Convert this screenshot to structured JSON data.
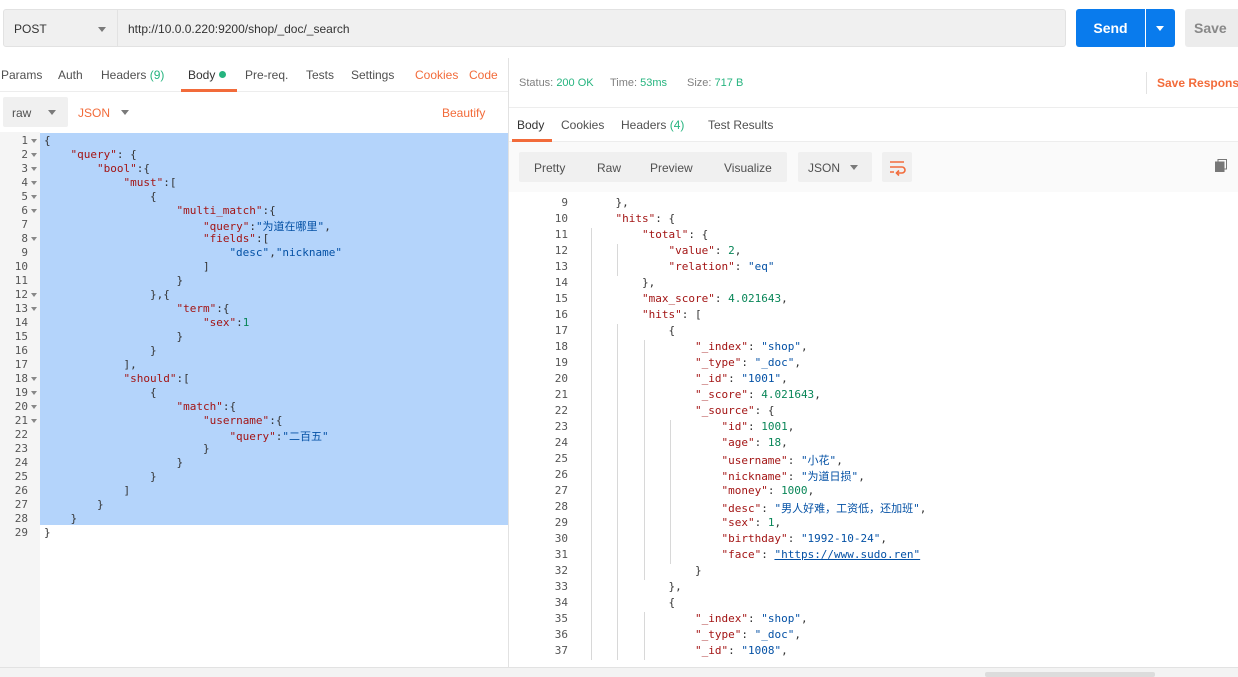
{
  "request": {
    "method": "POST",
    "url": "http://10.0.0.220:9200/shop/_doc/_search",
    "send_label": "Send",
    "save_label": "Save"
  },
  "request_tabs": [
    {
      "label": "Params"
    },
    {
      "label": "Auth"
    },
    {
      "label": "Headers",
      "count": "(9)"
    },
    {
      "label": "Body"
    },
    {
      "label": "Pre-req."
    },
    {
      "label": "Tests"
    },
    {
      "label": "Settings"
    },
    {
      "label": "Cookies"
    },
    {
      "label": "Code"
    }
  ],
  "body_options": {
    "mode": "raw",
    "format": "JSON",
    "beautify_label": "Beautify"
  },
  "request_body_lines": [
    "{",
    "    \"query\": {",
    "        \"bool\":{",
    "            \"must\":[",
    "                {",
    "                    \"multi_match\":{",
    "                        \"query\":\"为道在哪里\",",
    "                        \"fields\":[",
    "                            \"desc\",\"nickname\"",
    "                        ]",
    "                    }",
    "                },{",
    "                    \"term\":{",
    "                        \"sex\":1",
    "                    }",
    "                }",
    "            ],",
    "            \"should\":[",
    "                {",
    "                    \"match\":{",
    "                        \"username\":{",
    "                            \"query\":\"二百五\"",
    "                        }",
    "                    }",
    "                }",
    "            ]",
    "        }",
    "    }",
    "}"
  ],
  "request_fold_lines": [
    1,
    2,
    3,
    4,
    5,
    6,
    8,
    12,
    13,
    18,
    19,
    20,
    21
  ],
  "response_status": {
    "status_label": "Status:",
    "status": "200 OK",
    "time_label": "Time:",
    "time": "53ms",
    "size_label": "Size:",
    "size": "717 B",
    "save_response_label": "Save Response"
  },
  "response_tabs": [
    {
      "label": "Body"
    },
    {
      "label": "Cookies"
    },
    {
      "label": "Headers",
      "count": "(4)"
    },
    {
      "label": "Test Results"
    }
  ],
  "response_view": {
    "modes": [
      "Pretty",
      "Raw",
      "Preview",
      "Visualize"
    ],
    "format": "JSON"
  },
  "response_start_line": 9,
  "response_lines": [
    "    },",
    "    \"hits\": {",
    "        \"total\": {",
    "            \"value\": 2,",
    "            \"relation\": \"eq\"",
    "        },",
    "        \"max_score\": 4.021643,",
    "        \"hits\": [",
    "            {",
    "                \"_index\": \"shop\",",
    "                \"_type\": \"_doc\",",
    "                \"_id\": \"1001\",",
    "                \"_score\": 4.021643,",
    "                \"_source\": {",
    "                    \"id\": 1001,",
    "                    \"age\": 18,",
    "                    \"username\": \"小花\",",
    "                    \"nickname\": \"为道日损\",",
    "                    \"money\": 1000,",
    "                    \"desc\": \"男人好难，工资低，还加班\",",
    "                    \"sex\": 1,",
    "                    \"birthday\": \"1992-10-24\",",
    "                    \"face\": \"https://www.sudo.ren\"",
    "                }",
    "            },",
    "            {",
    "                \"_index\": \"shop\",",
    "                \"_type\": \"_doc\",",
    "                \"_id\": \"1008\","
  ],
  "colors": {
    "accent": "#f26b3a",
    "send_blue": "#097bed",
    "status_green": "#26b47f",
    "selection": "#b4d4fb"
  }
}
